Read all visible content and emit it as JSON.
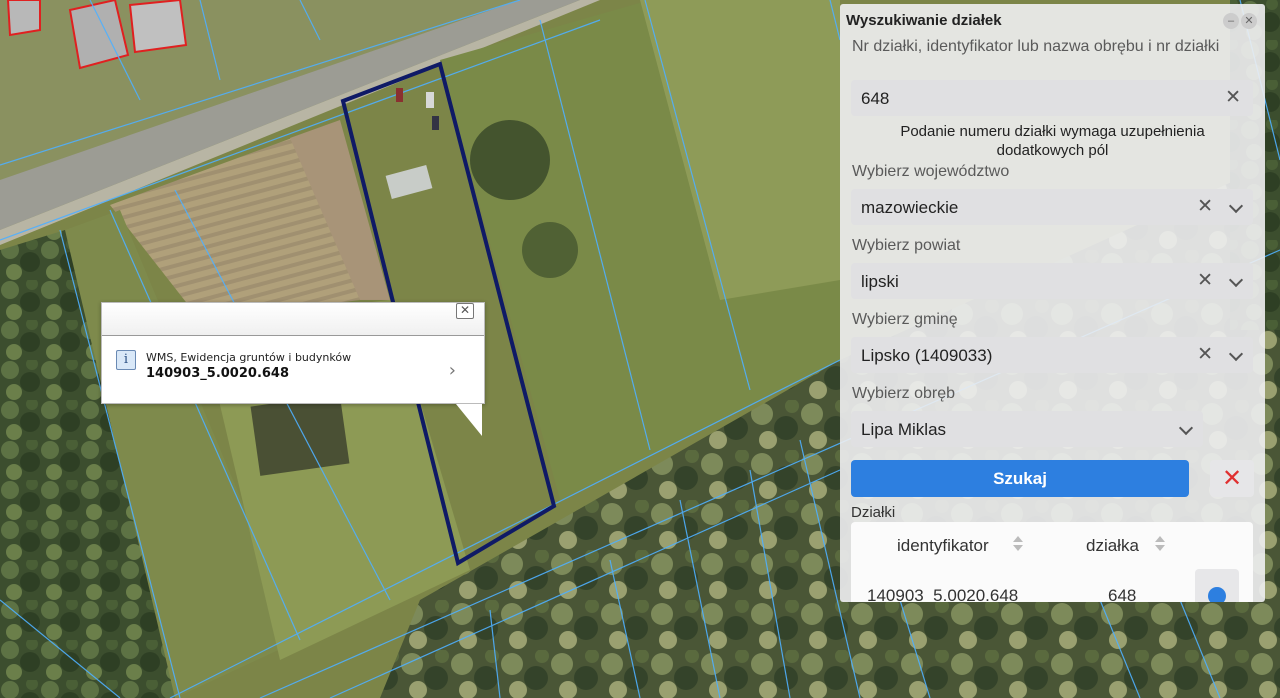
{
  "map": {
    "colors": {
      "parcel_line": "#4fb0ff",
      "highlight": "#0f1a66",
      "building_line": "#e02020",
      "road": "#9a9a92",
      "meadow": "#86904e",
      "forest": "#3a4c2c"
    }
  },
  "popup": {
    "close_icon": "close-icon",
    "info_icon": "info-icon",
    "source": "WMS, Ewidencja gruntów i budynków",
    "identifier": "140903_5.0020.648",
    "arrow": "›"
  },
  "panel": {
    "title": "Wyszukiwanie działek",
    "search": {
      "label": "Nr działki, identyfikator lub nazwa obrębu i nr działki",
      "value": "648"
    },
    "hint": "Podanie numeru działki wymaga uzupełnienia dodatkowych pól",
    "voivodeship": {
      "label": "Wybierz województwo",
      "value": "mazowieckie"
    },
    "county": {
      "label": "Wybierz powiat",
      "value": "lipski"
    },
    "commune": {
      "label": "Wybierz gminę",
      "value": "Lipsko (1409033)"
    },
    "precinct": {
      "label": "Wybierz obręb",
      "value": "Lipa Miklas"
    },
    "search_button": "Szukaj",
    "clear_button": "✕",
    "results": {
      "label": "Działki",
      "columns": [
        "identyfikator",
        "działka"
      ],
      "rows": [
        {
          "identifier": "140903_5.0020.648",
          "parcel": "648"
        }
      ]
    }
  }
}
